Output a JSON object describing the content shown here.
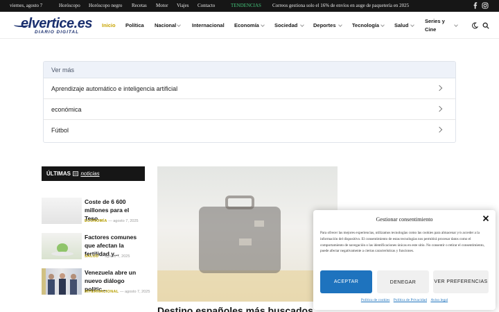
{
  "topbar": {
    "date": "viernes, agosto 7",
    "links": [
      "Horóscopo",
      "Horóscopo negro",
      "Recetas",
      "Motor",
      "Viajes",
      "Contacto"
    ],
    "trending_label": "TENDENCIAS",
    "trending_text": "Correos gestiona solo el 16% de envíos en auge de paquetería en 2025",
    "social": [
      "facebook-icon",
      "instagram-icon"
    ]
  },
  "header": {
    "logo_text": "elvertice.es",
    "logo_subtext": "DIARIO DIGITAL",
    "nav": [
      "Inicio",
      "Política",
      "Nacional",
      "Internacional",
      "Economía",
      "Sociedad",
      "Deportes",
      "Tecnología",
      "Salud",
      "Series y Cine"
    ],
    "active_nav": "Inicio",
    "accent": "#c8a400",
    "brand": "#1a2f6e"
  },
  "vermas": {
    "heading": "Ver más",
    "items": [
      "Aprendizaje automático e inteligencia artificial",
      "económica",
      "Fútbol"
    ]
  },
  "latest": {
    "heading_bold": "ÚLTIMAS",
    "heading_rest": "noticias",
    "posts": [
      {
        "title": "Coste de 6 600 millones para el Teso...",
        "category": "ECONOMÍA",
        "date": "agosto 7, 2025"
      },
      {
        "title": "Factores comunes que afectan la fertilidad y...",
        "category": "SALUD",
        "date": "agosto 7, 2025"
      },
      {
        "title": "Venezuela abre un nuevo diálogo politic...",
        "category": "INTERNACIONAL",
        "date": "agosto 7, 2025"
      }
    ]
  },
  "feature": {
    "title_fragment": "Destino españoles más buscados"
  },
  "consent": {
    "title": "Gestionar consentimiento",
    "text": "Para ofrecer las mejores experiencias, utilizamos tecnologías como las cookies para almacenar y/o acceder a la información del dispositivo. El consentimiento de estas tecnologías nos permitirá procesar datos como el comportamiento de navegación o las identificaciones únicas en este sitio. No consentir o retirar el consentimiento, puede afectar negativamente a ciertas características y funciones.",
    "accept": "ACEPTAR",
    "deny": "DENEGAR",
    "prefs": "VER PREFERENCIAS",
    "links": [
      "Política de cookies",
      "Política de Privacidad",
      "Aviso legal"
    ],
    "accent": "#1e73be"
  }
}
